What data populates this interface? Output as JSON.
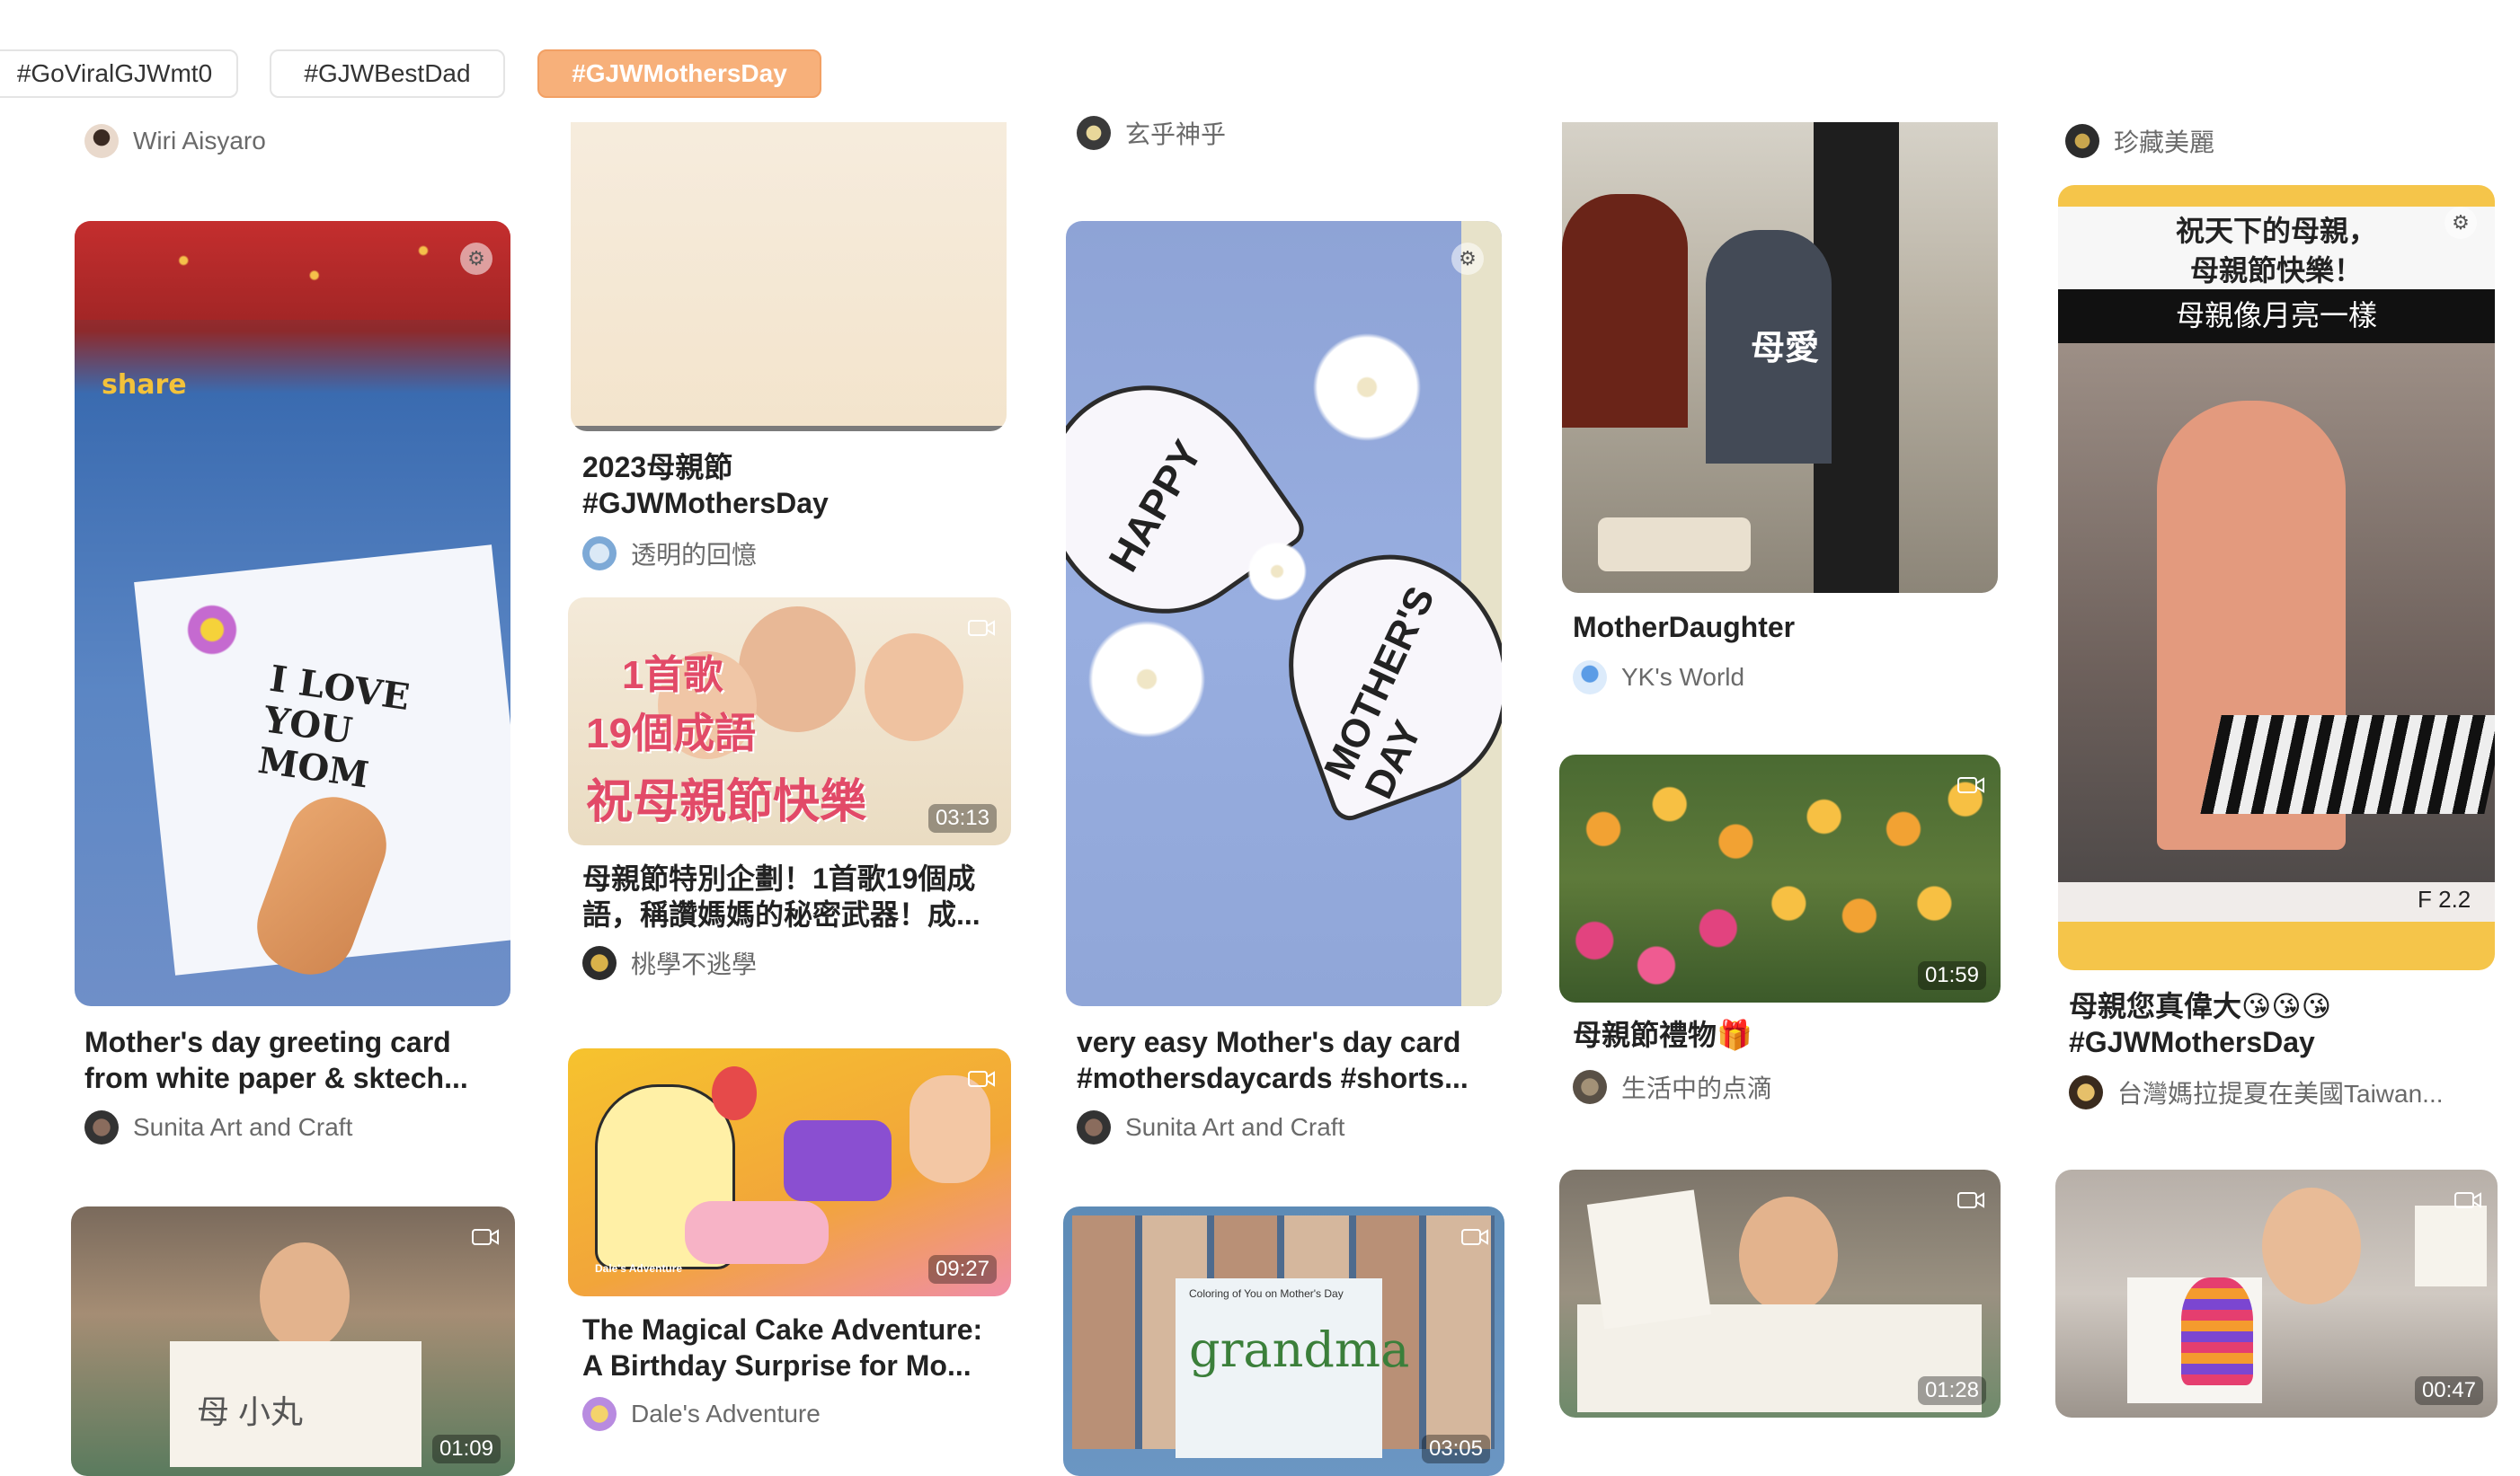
{
  "tags": [
    {
      "label": "#GoViralGJWmt0",
      "active": false
    },
    {
      "label": "#GJWBestDad",
      "active": false
    },
    {
      "label": "#GJWMothersDay",
      "active": true
    }
  ],
  "columns": {
    "col1": {
      "top_author": "Wiri Aisyaro",
      "card1": {
        "title_line1": "Mother's day greeting card",
        "title_line2": "from white paper & sktech...",
        "author": "Sunita Art and Craft",
        "overlay_top": "share",
        "overlay_card": "I LOVE YOU MOM"
      },
      "card2": {
        "duration": "01:09",
        "overlay": "母 小丸"
      }
    },
    "col2": {
      "card1": {
        "title_line1": "2023母親節",
        "title_line2": "#GJWMothersDay",
        "author": "透明的回憶"
      },
      "card2": {
        "duration": "03:13",
        "overlay_line1": "1首歌",
        "overlay_line2": "19個成語",
        "overlay_line3": "祝母親節快樂",
        "title_line1": "母親節特別企劃！1首歌19個成",
        "title_line2": "語，稱讚媽媽的秘密武器！成...",
        "author": "桃學不逃學"
      },
      "card3": {
        "duration": "09:27",
        "title_line1": "The Magical Cake Adventure:",
        "title_line2": "A Birthday Surprise for Mo...",
        "author": "Dale's Adventure",
        "logo_text": "Dale's Adventure"
      }
    },
    "col3": {
      "top_author": "玄乎神乎",
      "card1": {
        "title_line1": "very easy Mother's day card",
        "title_line2": "#mothersdaycards #shorts...",
        "author": "Sunita Art and Craft",
        "overlay_happy": "HAPPY",
        "overlay_mothers": "MOTHER'S DAY"
      },
      "card2": {
        "duration": "03:05",
        "overlay": "grandma",
        "small_text": "Coloring of You on Mother's Day"
      }
    },
    "col4": {
      "card1": {
        "title": "MotherDaughter",
        "author": "YK's World",
        "overlay": "母愛"
      },
      "card2": {
        "duration": "01:59",
        "title": "母親節禮物🎁",
        "author": "生活中的点滴"
      },
      "card3": {
        "duration": "01:28"
      }
    },
    "col5": {
      "top_author": "珍藏美麗",
      "card1": {
        "overlay_line1": "祝天下的母親，",
        "overlay_line2": "母親節快樂！",
        "overlay_line3": "母親像月亮一樣",
        "overlay_bottom": "F 2.2",
        "title_line1": "母親您真偉大😘😘😘",
        "title_line2": "#GJWMothersDay",
        "author": "台灣媽拉提夏在美國Taiwan..."
      },
      "card2": {
        "duration": "00:47"
      }
    }
  },
  "icons": {
    "video": "video-camera-icon",
    "image": "settings-gear-icon"
  },
  "colors": {
    "accent": "#f7b07a",
    "text": "#222222",
    "muted": "#6a6a6a"
  }
}
